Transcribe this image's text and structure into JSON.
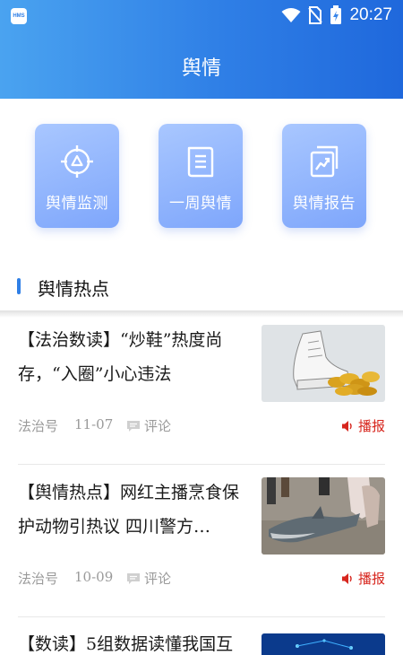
{
  "status_bar": {
    "app_badge": "HMS",
    "time": "20:27"
  },
  "header": {
    "title": "舆情"
  },
  "quick_actions": [
    {
      "label": "舆情监测",
      "icon": "monitor-target-icon"
    },
    {
      "label": "一周舆情",
      "icon": "weekly-doc-icon"
    },
    {
      "label": "舆情报告",
      "icon": "report-chart-icon"
    }
  ],
  "section": {
    "title": "舆情热点"
  },
  "news": [
    {
      "title": "【法治数读】“炒鞋”热度尚存，“入圈”小心违法",
      "source": "法治号",
      "date": "11-07",
      "comment_label": "评论",
      "broadcast_label": "播报",
      "thumb": "sneaker-and-coins-image"
    },
    {
      "title": "【舆情热点】网红主播烹食保护动物引热议 四川警方…",
      "source": "法治号",
      "date": "10-09",
      "comment_label": "评论",
      "broadcast_label": "播报",
      "thumb": "shark-on-beach-image"
    },
    {
      "title": "【数读】5组数据读懂我国互",
      "thumb": "blue-tech-image"
    }
  ],
  "colors": {
    "brand_blue": "#2f7fe6",
    "broadcast_red": "#d7261e",
    "tile_blue": "#8fb3fd"
  }
}
